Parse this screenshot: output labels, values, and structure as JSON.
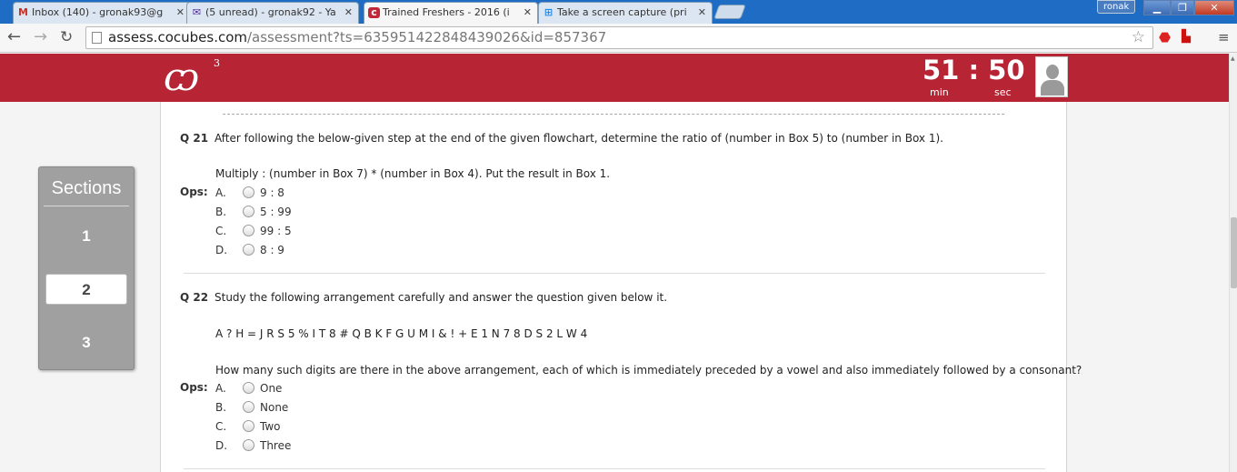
{
  "browser": {
    "tabs": [
      {
        "title": "Inbox (140) - gronak93@g",
        "icon": "gmail-icon"
      },
      {
        "title": "(5 unread) - gronak92 - Ya",
        "icon": "yahoo-mail-icon"
      },
      {
        "title": "Trained Freshers - 2016 (i",
        "icon": "cocubes-icon",
        "active": true
      },
      {
        "title": "Take a screen capture (pri",
        "icon": "windows-icon"
      }
    ],
    "user": "ronak",
    "url_host": "assess.cocubes.com",
    "url_path": "/assessment?ts=635951422848439026&id=857367"
  },
  "header": {
    "logo_sup": "3",
    "timer_value": "51 : 50",
    "timer_min_label": "min",
    "timer_sec_label": "sec",
    "accent_color": "#b72535"
  },
  "sections": {
    "title": "Sections",
    "items": [
      "1",
      "2",
      "3"
    ],
    "active": "2"
  },
  "ops_label": "Ops:",
  "questions": [
    {
      "number": "Q 21",
      "text": "After following the below-given step at the end of the given flowchart, determine the ratio of (number in Box 5) to (number in Box 1).",
      "extra": "Multiply : (number in Box 7) * (number in Box 4). Put the result in Box 1.",
      "options": [
        {
          "letter": "A.",
          "text": "9 : 8"
        },
        {
          "letter": "B.",
          "text": "5 : 99"
        },
        {
          "letter": "C.",
          "text": "99 : 5"
        },
        {
          "letter": "D.",
          "text": "8 : 9"
        }
      ]
    },
    {
      "number": "Q 22",
      "text": "Study the following arrangement carefully and answer the question given below it.",
      "arrangement": "A ? H = J R S 5 % I T 8 # Q B K F G U M I & ! + E 1 N 7 8 D S 2 L W 4",
      "sub_question": "How many such digits are there in the above arrangement, each of which is immediately preceded by a vowel and also immediately followed by a consonant?",
      "options": [
        {
          "letter": "A.",
          "text": "One"
        },
        {
          "letter": "B.",
          "text": "None"
        },
        {
          "letter": "C.",
          "text": "Two"
        },
        {
          "letter": "D.",
          "text": "Three"
        }
      ]
    }
  ]
}
